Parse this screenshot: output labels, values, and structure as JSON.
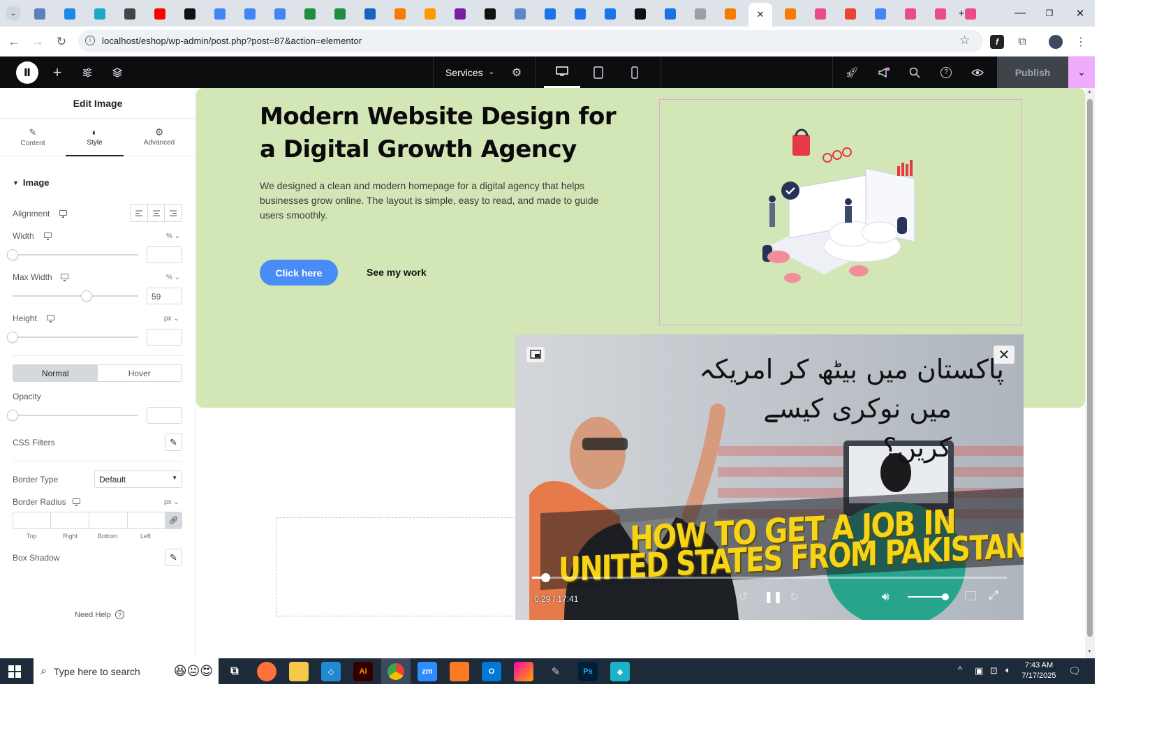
{
  "browser": {
    "address_url": "localhost/eshop/wp-admin/post.php?post=87&action=elementor",
    "favicons": [
      "#5b7fbf",
      "#1e88e5",
      "#1ea7c6",
      "#444",
      "#ff0000",
      "#111",
      "#4285f4",
      "#4285f4",
      "#4285f4",
      "#1e8e3e",
      "#1e8e3e",
      "#1565c0",
      "#f57c00",
      "#ff9800",
      "#7b1fa2",
      "#111",
      "#5b87c6",
      "#1a73e8",
      "#1a73e8",
      "#1a73e8",
      "#111",
      "#1a73e8",
      "#9aa0a6",
      "#f57c00",
      "active",
      "#f57c00",
      "#ea4c89",
      "#ea4335",
      "#4285f4",
      "#ea4c89",
      "#ea4c89",
      "#ea4c89"
    ]
  },
  "elementor": {
    "page_selector": "Services",
    "publish_label": "Publish"
  },
  "panel": {
    "title": "Edit Image",
    "tabs": [
      {
        "label": "Content",
        "icon": "pencil-icon"
      },
      {
        "label": "Style",
        "icon": "half-circle-icon",
        "active": true
      },
      {
        "label": "Advanced",
        "icon": "gear-icon"
      }
    ],
    "section_title": "Image",
    "alignment_label": "Alignment",
    "width_label": "Width",
    "width_unit": "%",
    "width_value": "",
    "max_width_label": "Max Width",
    "max_width_unit": "%",
    "max_width_value": "59",
    "height_label": "Height",
    "height_unit": "px",
    "height_value": "",
    "state_normal": "Normal",
    "state_hover": "Hover",
    "opacity_label": "Opacity",
    "opacity_value": "",
    "css_filters_label": "CSS Filters",
    "border_type_label": "Border Type",
    "border_type_value": "Default",
    "border_radius_label": "Border Radius",
    "border_radius_unit": "px",
    "radius_fields": [
      "Top",
      "Right",
      "Bottom",
      "Left"
    ],
    "box_shadow_label": "Box Shadow",
    "need_help": "Need Help",
    "sliders": {
      "width": 0,
      "max_width": 0.59,
      "height": 0,
      "opacity": 0
    }
  },
  "hero": {
    "title": "Modern Website Design for a Digital Growth Agency",
    "description": "We designed a clean and modern homepage for a digital agency that helps businesses grow online. The layout is simple, easy to read, and made to guide users smoothly.",
    "primary_button": "Click here",
    "secondary_link": "See my work"
  },
  "video": {
    "urdu_line1": "پاکستان میں بیٹھ کر امریکہ",
    "urdu_line2": "میں نوکری کیسے کریں؟",
    "headline1": "HOW TO GET A JOB IN",
    "headline2": "UNITED STATES FROM PAKISTAN",
    "time": "0:29 / 17:41",
    "progress": 0.028
  },
  "taskbar": {
    "search_placeholder": "Type here to search",
    "time": "7:43 AM",
    "date": "7/17/2025"
  }
}
